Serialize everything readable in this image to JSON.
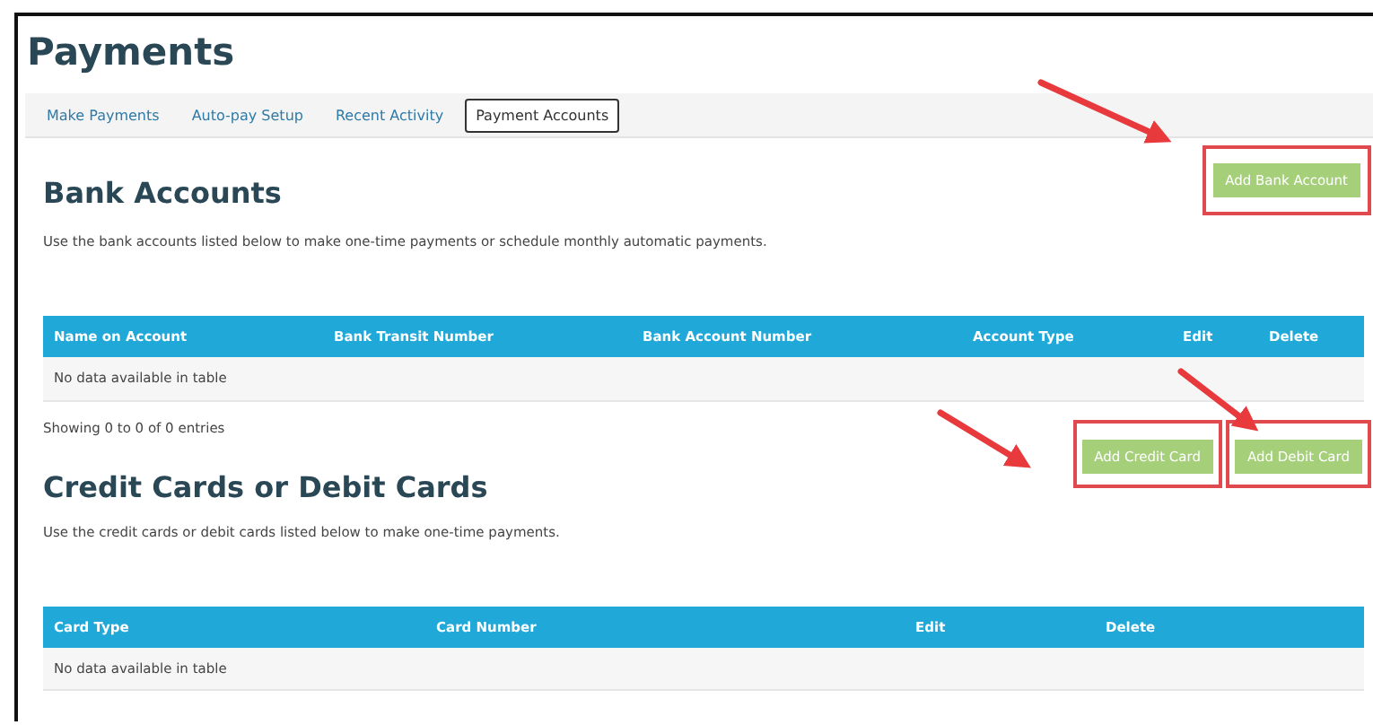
{
  "page_title": "Payments",
  "tabs": [
    {
      "label": "Make Payments",
      "selected": false
    },
    {
      "label": "Auto-pay Setup",
      "selected": false
    },
    {
      "label": "Recent Activity",
      "selected": false
    },
    {
      "label": "Payment Accounts",
      "selected": true
    }
  ],
  "bank_accounts": {
    "heading": "Bank Accounts",
    "description": "Use the bank accounts listed below to make one-time payments or schedule monthly automatic payments.",
    "buttons": [
      "Add Bank Account"
    ],
    "table": {
      "columns": [
        "Name on Account",
        "Bank Transit Number",
        "Bank Account Number",
        "Account Type",
        "Edit",
        "Delete"
      ],
      "empty_message": "No data available in table"
    },
    "info": "Showing 0 to 0 of 0 entries"
  },
  "cards": {
    "heading": "Credit Cards or Debit Cards",
    "description": "Use the credit cards or debit cards listed below to make one-time payments.",
    "buttons": [
      "Add Credit Card",
      "Add Debit Card"
    ],
    "table": {
      "columns": [
        "Card Type",
        "Card Number",
        "Edit",
        "Delete"
      ],
      "empty_message": "No data available in table"
    }
  }
}
